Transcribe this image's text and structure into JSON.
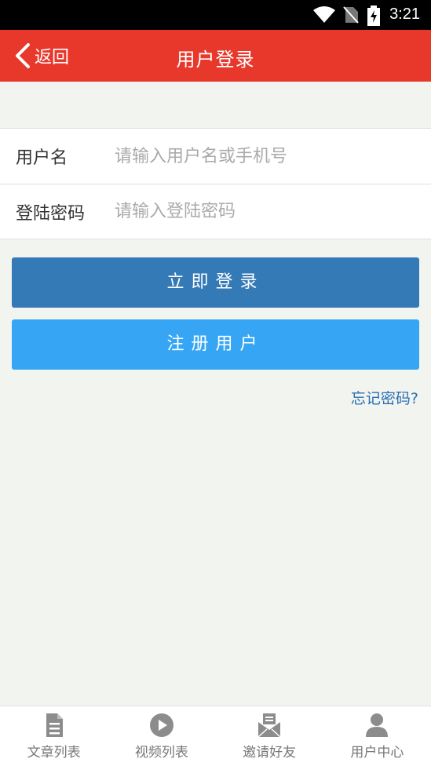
{
  "status_bar": {
    "time": "3:21"
  },
  "header": {
    "back_label": "返回",
    "title": "用户登录"
  },
  "form": {
    "username": {
      "label": "用户名",
      "placeholder": "请输入用户名或手机号",
      "value": ""
    },
    "password": {
      "label": "登陆密码",
      "placeholder": "请输入登陆密码",
      "value": ""
    }
  },
  "buttons": {
    "login": "立即登录",
    "register": "注册用户"
  },
  "forgot_password": "忘记密码?",
  "tabbar": {
    "items": [
      {
        "label": "文章列表",
        "icon": "document-icon"
      },
      {
        "label": "视频列表",
        "icon": "play-icon"
      },
      {
        "label": "邀请好友",
        "icon": "envelope-icon"
      },
      {
        "label": "用户中心",
        "icon": "user-icon"
      }
    ]
  },
  "colors": {
    "header": "#e8382c",
    "login_button": "#337ab7",
    "register_button": "#36a6f4",
    "link": "#2a6fb3",
    "background": "#f2f4ef"
  }
}
